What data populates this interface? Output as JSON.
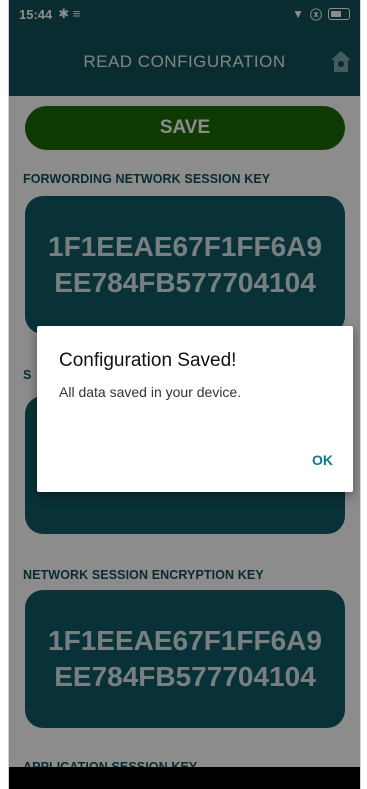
{
  "status_bar": {
    "time": "15:44",
    "left_icons": "✱ ≡",
    "wifi": "▼",
    "sim": "ⓧ"
  },
  "app_bar": {
    "title": "READ CONFIGURATION"
  },
  "main": {
    "save_label": "SAVE",
    "sections": [
      {
        "label": "FORWORDING NETWORK SESSION KEY",
        "key_line1": "1F1EEAE67F1FF6A9",
        "key_line2": "EE784FB577704104"
      },
      {
        "label": "S",
        "key_line1": "",
        "key_line2": ""
      },
      {
        "label": "NETWORK SESSION ENCRYPTION KEY",
        "key_line1": "1F1EEAE67F1FF6A9",
        "key_line2": "EE784FB577704104"
      },
      {
        "label": "APPLICATION SESSION KEY"
      }
    ]
  },
  "dialog": {
    "title": "Configuration Saved!",
    "message": "All data saved in your device.",
    "ok_label": "OK"
  },
  "colors": {
    "primary": "#0f5156",
    "card": "#0f5b66",
    "save_button": "#1c6a06",
    "accent": "#0f7a8a"
  },
  "icons": [
    "bluetooth-icon",
    "wifi-icon",
    "battery-icon",
    "home-icon"
  ]
}
